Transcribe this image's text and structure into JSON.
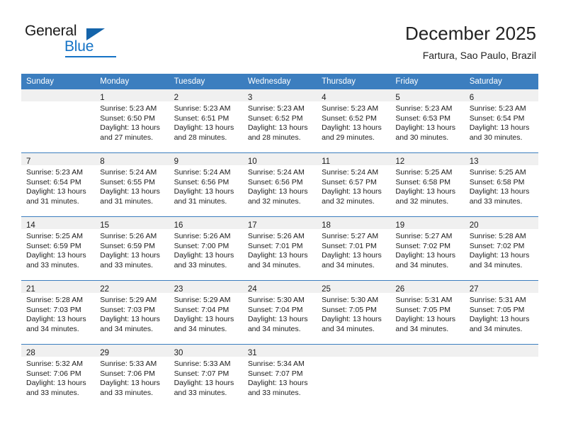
{
  "logo": {
    "word_top": "General",
    "word_bottom": "Blue"
  },
  "header": {
    "title": "December 2025",
    "subtitle": "Fartura, Sao Paulo, Brazil"
  },
  "theme": {
    "header_blue": "#3c7ebf",
    "logo_blue": "#1573c6",
    "daynum_band": "#f0f0f0",
    "text": "#1c1c1c"
  },
  "weekdays": [
    "Sunday",
    "Monday",
    "Tuesday",
    "Wednesday",
    "Thursday",
    "Friday",
    "Saturday"
  ],
  "labels": {
    "sunrise_prefix": "Sunrise:",
    "sunset_prefix": "Sunset:",
    "daylight_prefix": "Daylight:"
  },
  "weeks": [
    [
      {
        "day": "",
        "sunrise": "",
        "sunset": "",
        "daylight_line1": "",
        "daylight_line2": ""
      },
      {
        "day": "1",
        "sunrise": "Sunrise: 5:23 AM",
        "sunset": "Sunset: 6:50 PM",
        "daylight_line1": "Daylight: 13 hours",
        "daylight_line2": "and 27 minutes."
      },
      {
        "day": "2",
        "sunrise": "Sunrise: 5:23 AM",
        "sunset": "Sunset: 6:51 PM",
        "daylight_line1": "Daylight: 13 hours",
        "daylight_line2": "and 28 minutes."
      },
      {
        "day": "3",
        "sunrise": "Sunrise: 5:23 AM",
        "sunset": "Sunset: 6:52 PM",
        "daylight_line1": "Daylight: 13 hours",
        "daylight_line2": "and 28 minutes."
      },
      {
        "day": "4",
        "sunrise": "Sunrise: 5:23 AM",
        "sunset": "Sunset: 6:52 PM",
        "daylight_line1": "Daylight: 13 hours",
        "daylight_line2": "and 29 minutes."
      },
      {
        "day": "5",
        "sunrise": "Sunrise: 5:23 AM",
        "sunset": "Sunset: 6:53 PM",
        "daylight_line1": "Daylight: 13 hours",
        "daylight_line2": "and 30 minutes."
      },
      {
        "day": "6",
        "sunrise": "Sunrise: 5:23 AM",
        "sunset": "Sunset: 6:54 PM",
        "daylight_line1": "Daylight: 13 hours",
        "daylight_line2": "and 30 minutes."
      }
    ],
    [
      {
        "day": "7",
        "sunrise": "Sunrise: 5:23 AM",
        "sunset": "Sunset: 6:54 PM",
        "daylight_line1": "Daylight: 13 hours",
        "daylight_line2": "and 31 minutes."
      },
      {
        "day": "8",
        "sunrise": "Sunrise: 5:24 AM",
        "sunset": "Sunset: 6:55 PM",
        "daylight_line1": "Daylight: 13 hours",
        "daylight_line2": "and 31 minutes."
      },
      {
        "day": "9",
        "sunrise": "Sunrise: 5:24 AM",
        "sunset": "Sunset: 6:56 PM",
        "daylight_line1": "Daylight: 13 hours",
        "daylight_line2": "and 31 minutes."
      },
      {
        "day": "10",
        "sunrise": "Sunrise: 5:24 AM",
        "sunset": "Sunset: 6:56 PM",
        "daylight_line1": "Daylight: 13 hours",
        "daylight_line2": "and 32 minutes."
      },
      {
        "day": "11",
        "sunrise": "Sunrise: 5:24 AM",
        "sunset": "Sunset: 6:57 PM",
        "daylight_line1": "Daylight: 13 hours",
        "daylight_line2": "and 32 minutes."
      },
      {
        "day": "12",
        "sunrise": "Sunrise: 5:25 AM",
        "sunset": "Sunset: 6:58 PM",
        "daylight_line1": "Daylight: 13 hours",
        "daylight_line2": "and 32 minutes."
      },
      {
        "day": "13",
        "sunrise": "Sunrise: 5:25 AM",
        "sunset": "Sunset: 6:58 PM",
        "daylight_line1": "Daylight: 13 hours",
        "daylight_line2": "and 33 minutes."
      }
    ],
    [
      {
        "day": "14",
        "sunrise": "Sunrise: 5:25 AM",
        "sunset": "Sunset: 6:59 PM",
        "daylight_line1": "Daylight: 13 hours",
        "daylight_line2": "and 33 minutes."
      },
      {
        "day": "15",
        "sunrise": "Sunrise: 5:26 AM",
        "sunset": "Sunset: 6:59 PM",
        "daylight_line1": "Daylight: 13 hours",
        "daylight_line2": "and 33 minutes."
      },
      {
        "day": "16",
        "sunrise": "Sunrise: 5:26 AM",
        "sunset": "Sunset: 7:00 PM",
        "daylight_line1": "Daylight: 13 hours",
        "daylight_line2": "and 33 minutes."
      },
      {
        "day": "17",
        "sunrise": "Sunrise: 5:26 AM",
        "sunset": "Sunset: 7:01 PM",
        "daylight_line1": "Daylight: 13 hours",
        "daylight_line2": "and 34 minutes."
      },
      {
        "day": "18",
        "sunrise": "Sunrise: 5:27 AM",
        "sunset": "Sunset: 7:01 PM",
        "daylight_line1": "Daylight: 13 hours",
        "daylight_line2": "and 34 minutes."
      },
      {
        "day": "19",
        "sunrise": "Sunrise: 5:27 AM",
        "sunset": "Sunset: 7:02 PM",
        "daylight_line1": "Daylight: 13 hours",
        "daylight_line2": "and 34 minutes."
      },
      {
        "day": "20",
        "sunrise": "Sunrise: 5:28 AM",
        "sunset": "Sunset: 7:02 PM",
        "daylight_line1": "Daylight: 13 hours",
        "daylight_line2": "and 34 minutes."
      }
    ],
    [
      {
        "day": "21",
        "sunrise": "Sunrise: 5:28 AM",
        "sunset": "Sunset: 7:03 PM",
        "daylight_line1": "Daylight: 13 hours",
        "daylight_line2": "and 34 minutes."
      },
      {
        "day": "22",
        "sunrise": "Sunrise: 5:29 AM",
        "sunset": "Sunset: 7:03 PM",
        "daylight_line1": "Daylight: 13 hours",
        "daylight_line2": "and 34 minutes."
      },
      {
        "day": "23",
        "sunrise": "Sunrise: 5:29 AM",
        "sunset": "Sunset: 7:04 PM",
        "daylight_line1": "Daylight: 13 hours",
        "daylight_line2": "and 34 minutes."
      },
      {
        "day": "24",
        "sunrise": "Sunrise: 5:30 AM",
        "sunset": "Sunset: 7:04 PM",
        "daylight_line1": "Daylight: 13 hours",
        "daylight_line2": "and 34 minutes."
      },
      {
        "day": "25",
        "sunrise": "Sunrise: 5:30 AM",
        "sunset": "Sunset: 7:05 PM",
        "daylight_line1": "Daylight: 13 hours",
        "daylight_line2": "and 34 minutes."
      },
      {
        "day": "26",
        "sunrise": "Sunrise: 5:31 AM",
        "sunset": "Sunset: 7:05 PM",
        "daylight_line1": "Daylight: 13 hours",
        "daylight_line2": "and 34 minutes."
      },
      {
        "day": "27",
        "sunrise": "Sunrise: 5:31 AM",
        "sunset": "Sunset: 7:05 PM",
        "daylight_line1": "Daylight: 13 hours",
        "daylight_line2": "and 34 minutes."
      }
    ],
    [
      {
        "day": "28",
        "sunrise": "Sunrise: 5:32 AM",
        "sunset": "Sunset: 7:06 PM",
        "daylight_line1": "Daylight: 13 hours",
        "daylight_line2": "and 33 minutes."
      },
      {
        "day": "29",
        "sunrise": "Sunrise: 5:33 AM",
        "sunset": "Sunset: 7:06 PM",
        "daylight_line1": "Daylight: 13 hours",
        "daylight_line2": "and 33 minutes."
      },
      {
        "day": "30",
        "sunrise": "Sunrise: 5:33 AM",
        "sunset": "Sunset: 7:07 PM",
        "daylight_line1": "Daylight: 13 hours",
        "daylight_line2": "and 33 minutes."
      },
      {
        "day": "31",
        "sunrise": "Sunrise: 5:34 AM",
        "sunset": "Sunset: 7:07 PM",
        "daylight_line1": "Daylight: 13 hours",
        "daylight_line2": "and 33 minutes."
      },
      {
        "day": "",
        "sunrise": "",
        "sunset": "",
        "daylight_line1": "",
        "daylight_line2": ""
      },
      {
        "day": "",
        "sunrise": "",
        "sunset": "",
        "daylight_line1": "",
        "daylight_line2": ""
      },
      {
        "day": "",
        "sunrise": "",
        "sunset": "",
        "daylight_line1": "",
        "daylight_line2": ""
      }
    ]
  ]
}
